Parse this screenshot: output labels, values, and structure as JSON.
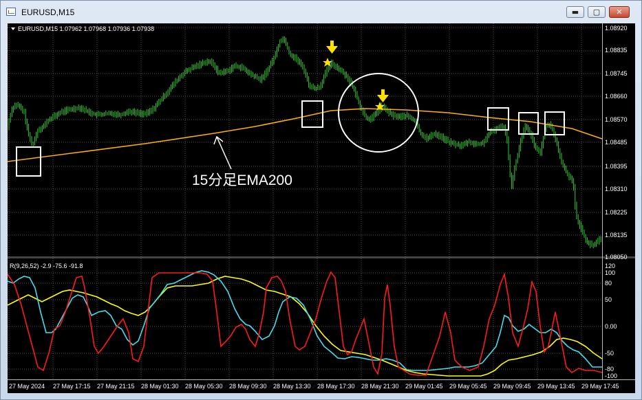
{
  "window": {
    "title": "EURUSD,M15",
    "min_glyph": "▬",
    "max_glyph": "▢",
    "close_glyph": "✕"
  },
  "main_chart": {
    "header": "EURUSD,M15  1.07962 1.07968 1.07936 1.07938",
    "price_axis": [
      "1.08920",
      "1.08835",
      "1.08745",
      "1.08660",
      "1.08570",
      "1.08485",
      "1.08395",
      "1.08310",
      "1.08225",
      "1.08135",
      "1.08050"
    ],
    "annotation": "15分足EMA200",
    "colors": {
      "candles": "#32cd32",
      "ema": "#ffb000",
      "arrow": "#ffff00",
      "box": "#ffffff"
    }
  },
  "sub_chart": {
    "header": "R(9,26,52) -2.9 -75.6 -91.8",
    "axis": [
      "120",
      "100",
      "80",
      "50",
      "0.00",
      "-50",
      "-80",
      "-100"
    ],
    "colors": {
      "fast": "#ff1a1a",
      "mid": "#40e0f0",
      "slow": "#ffff00"
    }
  },
  "time_axis": [
    "27 May 2024",
    "27 May 17:15",
    "27 May 21:15",
    "28 May 01:30",
    "28 May 05:30",
    "28 May 09:30",
    "28 May 13:30",
    "28 May 17:30",
    "28 May 21:30",
    "29 May 01:45",
    "29 May 05:45",
    "29 May 09:45",
    "29 May 13:45",
    "29 May 17:45"
  ]
}
